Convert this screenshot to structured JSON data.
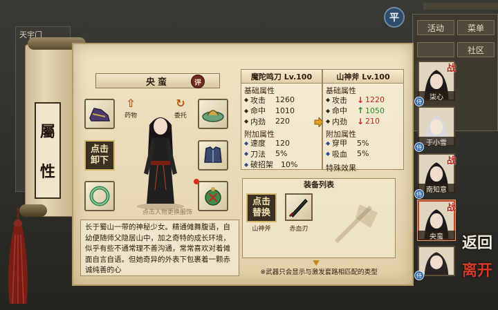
{
  "background": {
    "mode_icon": "平",
    "left_panel_title": "天宇门",
    "right_tabs": [
      "活动",
      "菜单",
      "",
      "社区"
    ]
  },
  "scroll_label": [
    "屬",
    "性"
  ],
  "character": {
    "name": "央蛮",
    "eval_label": "评",
    "icon_left_label": "药物",
    "icon_right_label": "委托",
    "unequip_line1": "点击",
    "unequip_line2": "卸下",
    "swap_hint": "点击人物更换服饰",
    "description": "长于蜀山一带的神秘少女。精通傩舞腹语，自幼便随师父隐居山中，加之奇特的成长环境，似乎有些不通常理不善沟通，常常喜欢对着傩面自言自语。但她奇异的外表下包裹着一颗赤诚纯善的心"
  },
  "current_weapon": {
    "title": "魔陀鸣刀 Lv.100",
    "base_header": "基础属性",
    "base": [
      {
        "k": "攻击",
        "v": "1260"
      },
      {
        "k": "命中",
        "v": "1010"
      },
      {
        "k": "内劲",
        "v": "220"
      }
    ],
    "extra_header": "附加属性",
    "extra": [
      {
        "k": "速度",
        "v": "120"
      },
      {
        "k": "刀法",
        "v": "5%"
      },
      {
        "k": "破招架",
        "v": "10%"
      }
    ]
  },
  "compare_weapon": {
    "title": "山神斧 Lv.100",
    "base_header": "基础属性",
    "base": [
      {
        "k": "攻击",
        "dir": "down",
        "v": "1220"
      },
      {
        "k": "命中",
        "dir": "up",
        "v": "1050"
      },
      {
        "k": "内劲",
        "dir": "down",
        "v": "210"
      }
    ],
    "extra_header": "附加属性",
    "extra": [
      {
        "k": "穿甲",
        "v": "5%"
      },
      {
        "k": "吸血",
        "v": "5%"
      }
    ],
    "special_header": "特殊效果"
  },
  "equip_list": {
    "title": "装备列表",
    "replace_line1": "点击",
    "replace_line2": "替换",
    "items": [
      "山神斧",
      "赤血刃"
    ]
  },
  "note": "※武器只会显示与激发套路相匹配的类型",
  "roster": [
    {
      "name": "柒心",
      "battle": "战",
      "skill": "侍",
      "selected": false
    },
    {
      "name": "于小雪",
      "battle": "",
      "skill": "侍",
      "selected": false
    },
    {
      "name": "南知意",
      "battle": "战",
      "skill": "侍",
      "selected": false
    },
    {
      "name": "央蛮",
      "battle": "战",
      "skill": "",
      "selected": true
    },
    {
      "name": "",
      "battle": "",
      "skill": "侍",
      "selected": false
    }
  ],
  "back_label": "返回",
  "leave_label": "离开",
  "colors": {
    "down": "#c0281c",
    "up": "#2a8a2a",
    "accent": "#b9492a"
  }
}
